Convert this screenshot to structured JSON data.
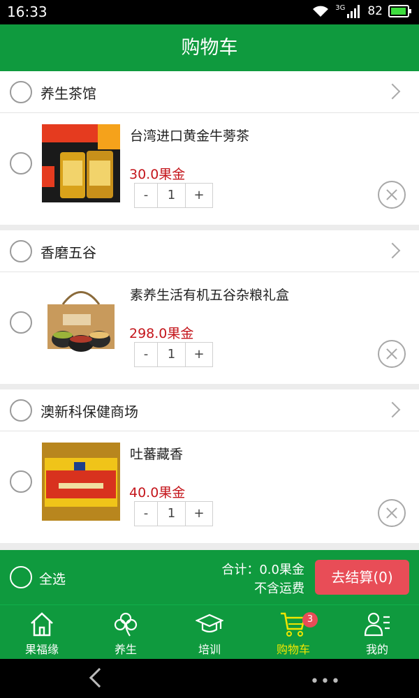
{
  "status_bar": {
    "time": "16:33",
    "network": "3G",
    "battery": "82",
    "battery_level": 0.82
  },
  "header": {
    "title": "购物车"
  },
  "shops": [
    {
      "name": "养生茶馆",
      "item": {
        "name": "台湾进口黄金牛蒡茶",
        "price": "30.0果金",
        "quantity": "1",
        "image": "burdock-tea-product"
      }
    },
    {
      "name": "香磨五谷",
      "item": {
        "name": "素养生活有机五谷杂粮礼盒",
        "price": "298.0果金",
        "quantity": "1",
        "image": "grain-gift-box-product"
      }
    },
    {
      "name": "澳新科保健商场",
      "item": {
        "name": "吐蕃藏香",
        "price": "40.0果金",
        "quantity": "1",
        "image": "tibetan-incense-product"
      }
    }
  ],
  "stepper": {
    "minus": "-",
    "plus": "+"
  },
  "checkout": {
    "select_all": "全选",
    "total": "合计：0.0果金",
    "shipping": "不含运费",
    "button": "去结算(0)"
  },
  "tabs": [
    {
      "label": "果福缘",
      "icon": "home-icon"
    },
    {
      "label": "养生",
      "icon": "clover-icon"
    },
    {
      "label": "培训",
      "icon": "graduation-cap-icon"
    },
    {
      "label": "购物车",
      "icon": "cart-icon",
      "badge": "3"
    },
    {
      "label": "我的",
      "icon": "profile-icon"
    }
  ],
  "colors": {
    "primary": "#0f9a3e",
    "price": "#c4161c",
    "checkout_button": "#e84d57",
    "active_tab": "#f2e600"
  }
}
